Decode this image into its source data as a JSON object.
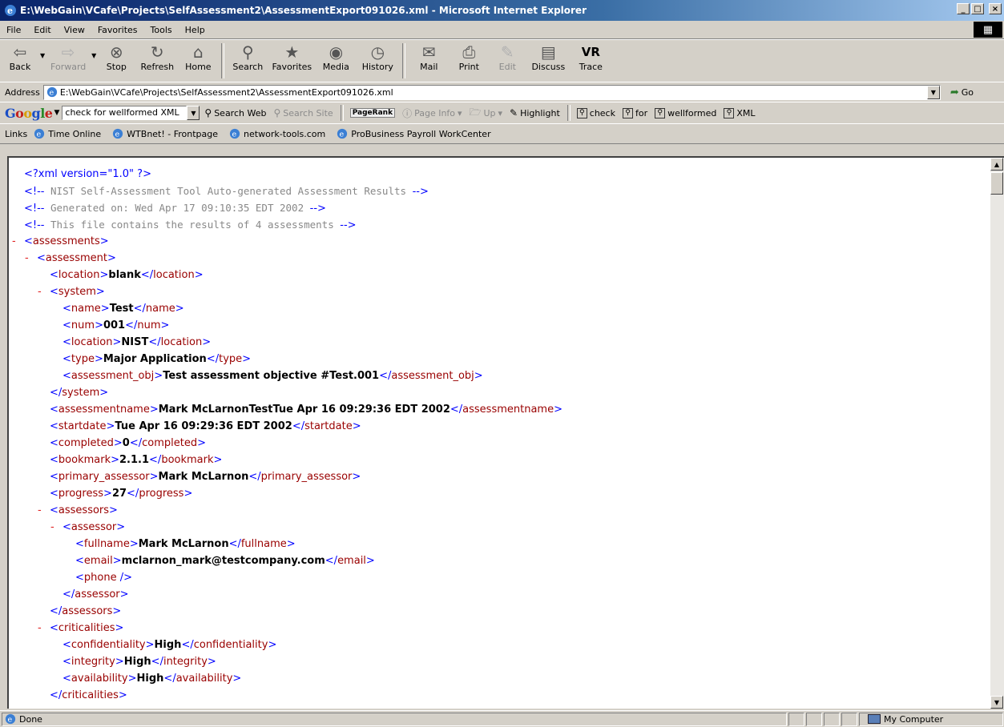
{
  "window": {
    "title": "E:\\WebGain\\VCafe\\Projects\\SelfAssessment2\\AssessmentExport091026.xml - Microsoft Internet Explorer",
    "min_label": "_",
    "max_label": "□",
    "close_label": "×"
  },
  "menu": [
    "File",
    "Edit",
    "View",
    "Favorites",
    "Tools",
    "Help"
  ],
  "toolbar": {
    "back": "Back",
    "forward": "Forward",
    "stop": "Stop",
    "refresh": "Refresh",
    "home": "Home",
    "search": "Search",
    "favorites": "Favorites",
    "media": "Media",
    "history": "History",
    "mail": "Mail",
    "print": "Print",
    "edit": "Edit",
    "discuss": "Discuss",
    "trace": "Trace"
  },
  "address": {
    "label": "Address",
    "value": "E:\\WebGain\\VCafe\\Projects\\SelfAssessment2\\AssessmentExport091026.xml",
    "go": "Go"
  },
  "google": {
    "query": "check for wellformed XML",
    "search_web": "Search Web",
    "search_site": "Search Site",
    "pagerank": "PageRank",
    "page_info": "Page Info",
    "up": "Up",
    "highlight": "Highlight",
    "terms": [
      "check",
      "for",
      "wellformed",
      "XML"
    ]
  },
  "links": {
    "label": "Links",
    "items": [
      "Time Online",
      "WTBnet! - Frontpage",
      "network-tools.com",
      "ProBusiness Payroll WorkCenter"
    ]
  },
  "xml_lines": [
    {
      "indent": 0,
      "kind": "pi",
      "text": "<?xml version=\"1.0\" ?>"
    },
    {
      "indent": 0,
      "kind": "comment",
      "text": "NIST Self-Assessment Tool Auto-generated Assessment Results"
    },
    {
      "indent": 0,
      "kind": "comment",
      "text": "Generated on: Wed Apr 17 09:10:35 EDT 2002"
    },
    {
      "indent": 0,
      "kind": "comment",
      "text": "This file contains the results of 4 assessments"
    },
    {
      "indent": 0,
      "kind": "open",
      "tag": "assessments",
      "minus": true
    },
    {
      "indent": 1,
      "kind": "open",
      "tag": "assessment",
      "minus": true
    },
    {
      "indent": 2,
      "kind": "elem",
      "tag": "location",
      "value": "blank"
    },
    {
      "indent": 2,
      "kind": "open",
      "tag": "system",
      "minus": true
    },
    {
      "indent": 3,
      "kind": "elem",
      "tag": "name",
      "value": "Test"
    },
    {
      "indent": 3,
      "kind": "elem",
      "tag": "num",
      "value": "001"
    },
    {
      "indent": 3,
      "kind": "elem",
      "tag": "location",
      "value": "NIST"
    },
    {
      "indent": 3,
      "kind": "elem",
      "tag": "type",
      "value": "Major Application"
    },
    {
      "indent": 3,
      "kind": "elem",
      "tag": "assessment_obj",
      "value": "Test assessment objective #Test.001"
    },
    {
      "indent": 2,
      "kind": "close",
      "tag": "system"
    },
    {
      "indent": 2,
      "kind": "elem",
      "tag": "assessmentname",
      "value": "Mark McLarnonTestTue Apr 16 09:29:36 EDT 2002"
    },
    {
      "indent": 2,
      "kind": "elem",
      "tag": "startdate",
      "value": "Tue Apr 16 09:29:36 EDT 2002"
    },
    {
      "indent": 2,
      "kind": "elem",
      "tag": "completed",
      "value": "0"
    },
    {
      "indent": 2,
      "kind": "elem",
      "tag": "bookmark",
      "value": "2.1.1"
    },
    {
      "indent": 2,
      "kind": "elem",
      "tag": "primary_assessor",
      "value": "Mark McLarnon"
    },
    {
      "indent": 2,
      "kind": "elem",
      "tag": "progress",
      "value": "27"
    },
    {
      "indent": 2,
      "kind": "open",
      "tag": "assessors",
      "minus": true
    },
    {
      "indent": 3,
      "kind": "open",
      "tag": "assessor",
      "minus": true
    },
    {
      "indent": 4,
      "kind": "elem",
      "tag": "fullname",
      "value": "Mark McLarnon"
    },
    {
      "indent": 4,
      "kind": "elem",
      "tag": "email",
      "value": "mclarnon_mark@testcompany.com"
    },
    {
      "indent": 4,
      "kind": "empty",
      "tag": "phone"
    },
    {
      "indent": 3,
      "kind": "close",
      "tag": "assessor"
    },
    {
      "indent": 2,
      "kind": "close",
      "tag": "assessors"
    },
    {
      "indent": 2,
      "kind": "open",
      "tag": "criticalities",
      "minus": true
    },
    {
      "indent": 3,
      "kind": "elem",
      "tag": "confidentiality",
      "value": "High"
    },
    {
      "indent": 3,
      "kind": "elem",
      "tag": "integrity",
      "value": "High"
    },
    {
      "indent": 3,
      "kind": "elem",
      "tag": "availability",
      "value": "High"
    },
    {
      "indent": 2,
      "kind": "close",
      "tag": "criticalities"
    }
  ],
  "status": {
    "text": "Done",
    "zone": "My Computer"
  }
}
